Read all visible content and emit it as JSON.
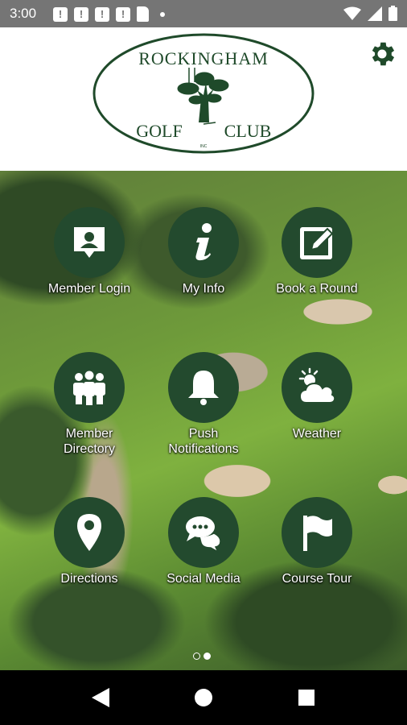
{
  "status_bar": {
    "time": "3:00",
    "notification_icons": [
      "message-icon",
      "message-icon",
      "message-icon",
      "message-icon",
      "sim-card-icon"
    ],
    "system_icons": [
      "wifi-icon",
      "signal-icon",
      "battery-icon"
    ]
  },
  "header": {
    "logo": {
      "line1": "ROCKINGHAM",
      "line2": "GOLF",
      "line3": "CLUB",
      "suffix": "INC"
    },
    "settings_icon": "gear-icon"
  },
  "tiles": [
    {
      "label": "Member Login",
      "icon": "member-card-icon"
    },
    {
      "label": "My Info",
      "icon": "info-icon"
    },
    {
      "label": "Book a Round",
      "icon": "edit-icon"
    },
    {
      "label": "Member\nDirectory",
      "icon": "people-icon"
    },
    {
      "label": "Push\nNotifications",
      "icon": "bell-icon"
    },
    {
      "label": "Weather",
      "icon": "weather-icon"
    },
    {
      "label": "Directions",
      "icon": "location-pin-icon"
    },
    {
      "label": "Social Media",
      "icon": "chat-icon"
    },
    {
      "label": "Course Tour",
      "icon": "flag-icon"
    }
  ],
  "pager": {
    "pages": 2,
    "current": 2
  },
  "nav_bar": {
    "buttons": [
      "back-icon",
      "home-icon",
      "recents-icon"
    ]
  },
  "colors": {
    "tile": "#234a2e",
    "brand_green": "#1f4a2a",
    "status_bar": "#757575"
  }
}
